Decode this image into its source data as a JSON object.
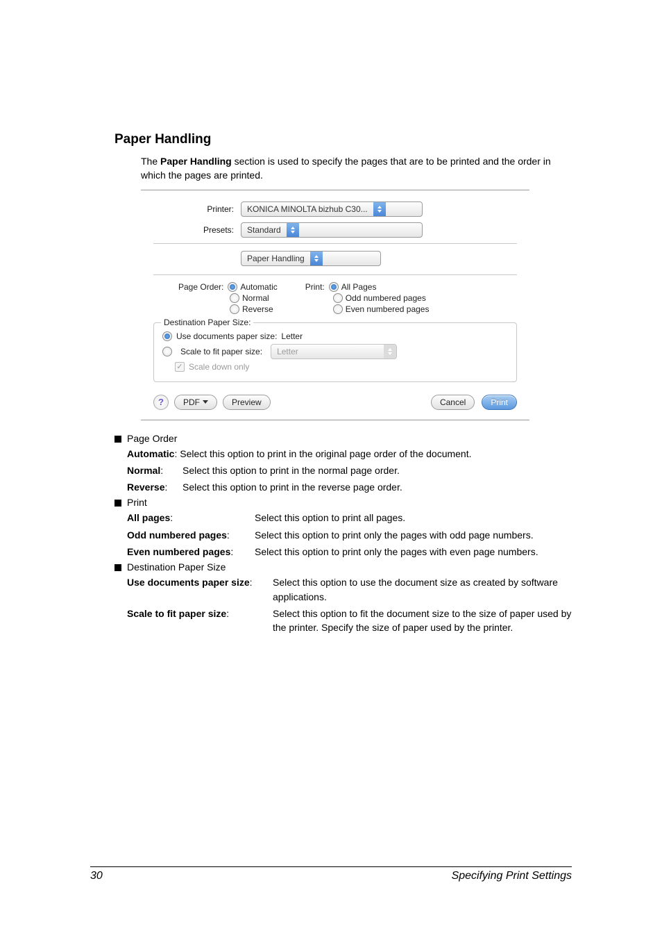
{
  "heading": "Paper Handling",
  "intro_parts": [
    "The ",
    "Paper Handling",
    " section is used to specify the pages that are to be printed and the order in which the pages are printed."
  ],
  "dialog": {
    "printer_label": "Printer:",
    "printer_value": "KONICA MINOLTA bizhub C30...",
    "presets_label": "Presets:",
    "presets_value": "Standard",
    "section_value": "Paper Handling",
    "page_order_label": "Page Order:",
    "page_order_options": [
      "Automatic",
      "Normal",
      "Reverse"
    ],
    "print_label": "Print:",
    "print_options": [
      "All Pages",
      "Odd numbered pages",
      "Even numbered pages"
    ],
    "dest_legend": "Destination Paper Size:",
    "use_docs_label": "Use documents paper size:",
    "use_docs_value": "Letter",
    "scale_label": "Scale to fit paper size:",
    "scale_value": "Letter",
    "scale_down_label": "Scale down only",
    "help": "?",
    "pdf_btn": "PDF",
    "preview_btn": "Preview",
    "cancel_btn": "Cancel",
    "print_btn": "Print"
  },
  "body": {
    "page_order_head": "Page Order",
    "automatic": {
      "term": "Automatic",
      "def": ": Select this option to print in the original page order of the document."
    },
    "normal": {
      "term": "Normal",
      "def": "Select this option to print in the normal page order."
    },
    "reverse": {
      "term": "Reverse",
      "def": "Select this option to print in the reverse page order."
    },
    "print_head": "Print",
    "all_pages": {
      "term": "All pages",
      "def": "Select this option to print all pages."
    },
    "odd_pages": {
      "term": "Odd numbered pages",
      "def": "Select this option to print only the pages with odd page numbers."
    },
    "even_pages": {
      "term": "Even numbered pages",
      "def": "Select this option to print only the pages with even page numbers."
    },
    "dest_head": "Destination Paper Size",
    "use_docs": {
      "term": "Use documents paper size",
      "def": "Select this option to use the document size as created by software applications."
    },
    "scale_fit": {
      "term": "Scale to fit paper size",
      "def": "Select this option to fit the document size to the size of paper used by the printer. Specify the size of paper used by the printer."
    }
  },
  "footer": {
    "page": "30",
    "title": "Specifying Print Settings"
  }
}
